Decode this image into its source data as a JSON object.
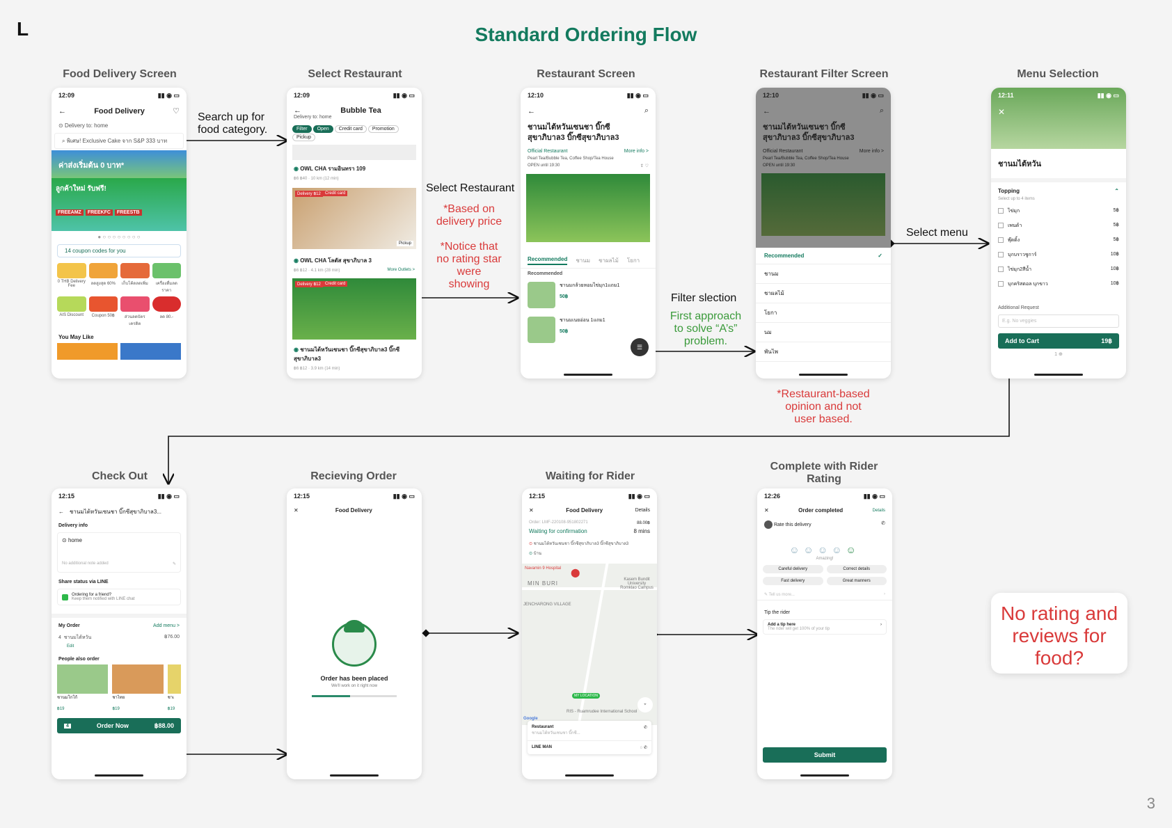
{
  "header": {
    "logo": "L",
    "title": "Standard Ordering Flow",
    "page_number": "3"
  },
  "screens": {
    "s1": {
      "label": "Food Delivery Screen",
      "time": "12:09",
      "title": "Food Delivery",
      "delivery": "Delivery to: home",
      "search": "พิเศษ! Exclusive Cake จาก S&P 333 บาท",
      "coupon": "14 coupon codes for you",
      "cats": [
        "0 THB Delivery Fee",
        "ลดสูงสุด 60%",
        "เก็บโค้ดลดเพิ่ม",
        "เครื่องดื่มลดราคา",
        "AIS Discount",
        "Coupon 50฿",
        "ส่วนลดบัตรเครดิต",
        "ลด 80.-"
      ],
      "youmay": "You May Like",
      "banner1": "ค่าส่งเริ่มต้น 0 บาท*",
      "banner2": "ลูกค้าใหม่ รับฟรี!",
      "b2_codes": [
        "FREEAMZ",
        "FREEKFC",
        "FREESTB"
      ]
    },
    "s2": {
      "label": "Select Restaurant",
      "time": "12:09",
      "title": "Bubble Tea",
      "delivery": "Delivery to: home",
      "chips": [
        "Filter",
        "Open",
        "Credit card",
        "Promotion",
        "Pickup"
      ],
      "r1": "OWL CHA รามอินทรา 109",
      "r1_meta": "฿6 ฿40 · 10 km (12 min)",
      "r2": "OWL CHA โลตัส สุขาภิบาล 3",
      "r2_meta": "฿6 ฿12 · 4.1 km (28 min)",
      "r2_more": "More Outlets >",
      "r3": "ชานมไต้หวันเซนชา บิ๊กซีสุขาภิบาล3 บิ๊กซีสุขาภิบาล3",
      "r3_meta": "฿6 ฿12 · 3.9 km (14 min)",
      "tag_delivery": "Delivery ฿12",
      "tag_credit": "Credit card",
      "pickup": "Pickup"
    },
    "s3": {
      "label": "Restaurant Screen",
      "time": "12:10",
      "name": "ชานมไต้หวันเซนชา บิ๊กซี สุขาภิบาล3 บิ๊กซีสุขาภิบาล3",
      "official": "Official Restaurant",
      "more": "More info >",
      "cat": "Pearl Tea/Bubble Tea, Coffee Shop/Tea House",
      "open": "OPEN  until 19:30",
      "tabs": [
        "Recommended",
        "ชานม",
        "ชาผลไม้",
        "โยกา"
      ],
      "section": "Recommended",
      "items": [
        {
          "name": "ชานมกล้วยหอมไข่มุก1แถม1",
          "price": "50฿"
        },
        {
          "name": "ชานมเนยอ่อน 1แถม1",
          "price": "50฿"
        }
      ]
    },
    "s4": {
      "label": "Restaurant Filter Screen",
      "time": "12:10",
      "name": "ชานมไต้หวันเซนชา บิ๊กซี สุขาภิบาล3 บิ๊กซีสุขาภิบาล3",
      "official": "Official Restaurant",
      "more": "More info >",
      "cat": "Pearl Tea/Bubble Tea, Coffee Shop/Tea House",
      "open": "OPEN  until 19:30",
      "list": [
        "Recommended",
        "ชานม",
        "ชาผลไม้",
        "โยกา",
        "นม",
        "พันไพ"
      ]
    },
    "s5": {
      "label": "Menu Selection",
      "time": "12:11",
      "name": "ชานมไต้หวัน",
      "topping": "Topping",
      "topping_sub": "Select up to 4 items",
      "toppings": [
        {
          "n": "ไข่มุก",
          "p": "5฿"
        },
        {
          "n": "เพนด้า",
          "p": "5฿"
        },
        {
          "n": "พุ๊ดดิ้ง",
          "p": "5฿"
        },
        {
          "n": "บุกบราวชูการ์",
          "p": "10฿"
        },
        {
          "n": "ไข่มุก2สีน้ำ",
          "p": "10฿"
        },
        {
          "n": "บุกคริสตอล บุกขาว",
          "p": "10฿"
        }
      ],
      "additional": "Additional Request",
      "additional_ph": "E.g. No veggies",
      "add": "Add to Cart",
      "add_price": "19฿",
      "qty": "1"
    },
    "s6": {
      "label": "Check Out",
      "time": "12:15",
      "title": "ชานมไต้หวันเซนชา บิ๊กซีสุขาภิบาล3...",
      "info": "Delivery info",
      "home": "home",
      "note": "No additional note added",
      "share": "Share status via LINE",
      "share1": "Ordering for a friend?",
      "share2": "Keep them notified with LINE chat",
      "myorder": "My Order",
      "addmenu": "Add menu >",
      "qty": "4",
      "item": "ชานมไต้หวัน",
      "edit": "Edit",
      "item_price": "฿76.00",
      "also": "People also order",
      "also_items": [
        {
          "n": "ชานมโกโก้",
          "p": "฿19"
        },
        {
          "n": "ชาไทย",
          "p": "฿19"
        },
        {
          "n": "ชาเ",
          "p": "฿19"
        }
      ],
      "order": "Order Now",
      "order_qty": "4",
      "total": "฿88.00"
    },
    "s7": {
      "label": "Recieving Order",
      "time": "12:15",
      "title": "Food Delivery",
      "placed": "Order has been placed",
      "working": "We'll work on it right now"
    },
    "s8": {
      "label": "Waiting for Rider",
      "time": "12:15",
      "title": "Food Delivery",
      "details": "Details",
      "order_no": "Order: LMF-220108-951802271",
      "amount": "88.00฿",
      "status": "Waiting for confirmation",
      "mins": "8 mins",
      "from": "ชานมไต้หวันเซนชา บิ๊กซีสุขาภิบาล3 บิ๊กซีสุขาภิบาล3",
      "to": "บ้าน",
      "map1": "Navamin 9 Hospital",
      "map2": "MIN BURI",
      "map3": "JENCHARONG VILLAGE",
      "map4": "Kasem Bundit University Romklao Campus",
      "map5": "MY LOCATION",
      "map6": "RIS - Ruamrudee International School",
      "google": "Google",
      "restaurant": "Restaurant",
      "rest_name": "ชานมไต้หวันเซนชา บิ๊กซี...",
      "lineman": "LINE MAN"
    },
    "s9": {
      "label": "Complete with Rider Rating",
      "time": "12:26",
      "title": "Order completed",
      "details": "Details",
      "rate": "Rate this delivery",
      "amazing": "Amazing!",
      "tags": [
        "Careful delivery",
        "Correct details",
        "Fast delivery",
        "Great manners"
      ],
      "tell": "Tell us more...",
      "tip": "Tip the rider",
      "tip1": "Add a tip here",
      "tip2": "The rider will get 100% of your tip",
      "submit": "Submit"
    }
  },
  "annotations": {
    "search": "Search up for\nfood category.",
    "select_rest": "Select Restaurant",
    "based": "*Based on\ndelivery price",
    "notice": "*Notice that\nno rating star\nwere\nshowing",
    "filter": "Filter slection",
    "first": "First approach\nto solve “A’s”\nproblem.",
    "restbased": "*Restaurant-based\nopinion and not\nuser based.",
    "select_menu": "Select menu",
    "norating": "No rating and\nreviews for\nfood?"
  },
  "colors": {
    "brand": "#137a5e",
    "button": "#196e58",
    "note_red": "#d93a3a",
    "note_green": "#3a9a3a"
  }
}
